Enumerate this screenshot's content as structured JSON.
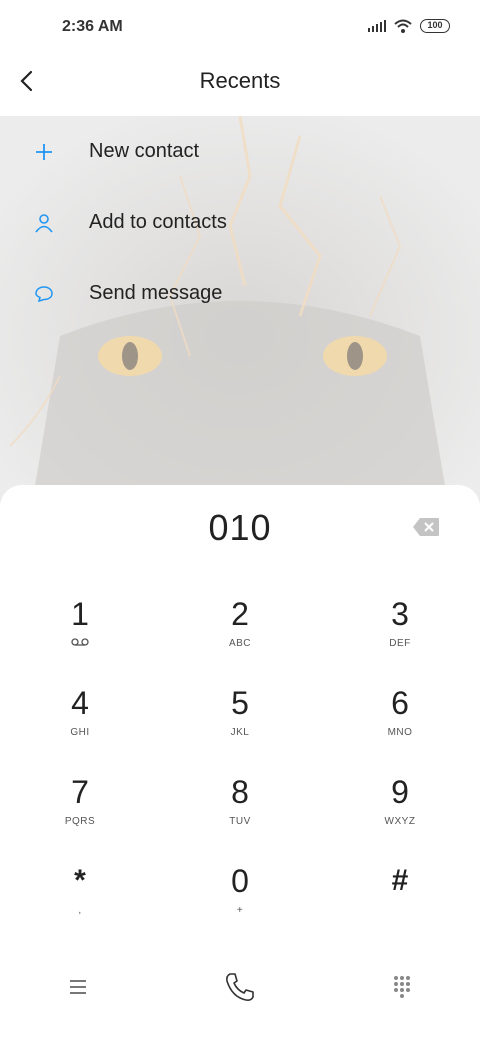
{
  "status_bar": {
    "time": "2:36 AM",
    "battery": "100"
  },
  "header": {
    "title": "Recents"
  },
  "actions": [
    {
      "label": "New contact",
      "icon": "plus-icon"
    },
    {
      "label": "Add to contacts",
      "icon": "person-icon"
    },
    {
      "label": "Send message",
      "icon": "chat-bubble-icon"
    }
  ],
  "dialer": {
    "number": "010",
    "keys": [
      {
        "digit": "1",
        "letters": ""
      },
      {
        "digit": "2",
        "letters": "ABC"
      },
      {
        "digit": "3",
        "letters": "DEF"
      },
      {
        "digit": "4",
        "letters": "GHI"
      },
      {
        "digit": "5",
        "letters": "JKL"
      },
      {
        "digit": "6",
        "letters": "MNO"
      },
      {
        "digit": "7",
        "letters": "PQRS"
      },
      {
        "digit": "8",
        "letters": "TUV"
      },
      {
        "digit": "9",
        "letters": "WXYZ"
      },
      {
        "digit": "*",
        "letters": ","
      },
      {
        "digit": "0",
        "letters": "+"
      },
      {
        "digit": "#",
        "letters": ""
      }
    ]
  },
  "colors": {
    "accent": "#2196f3",
    "text": "#222222",
    "muted": "#555555"
  }
}
